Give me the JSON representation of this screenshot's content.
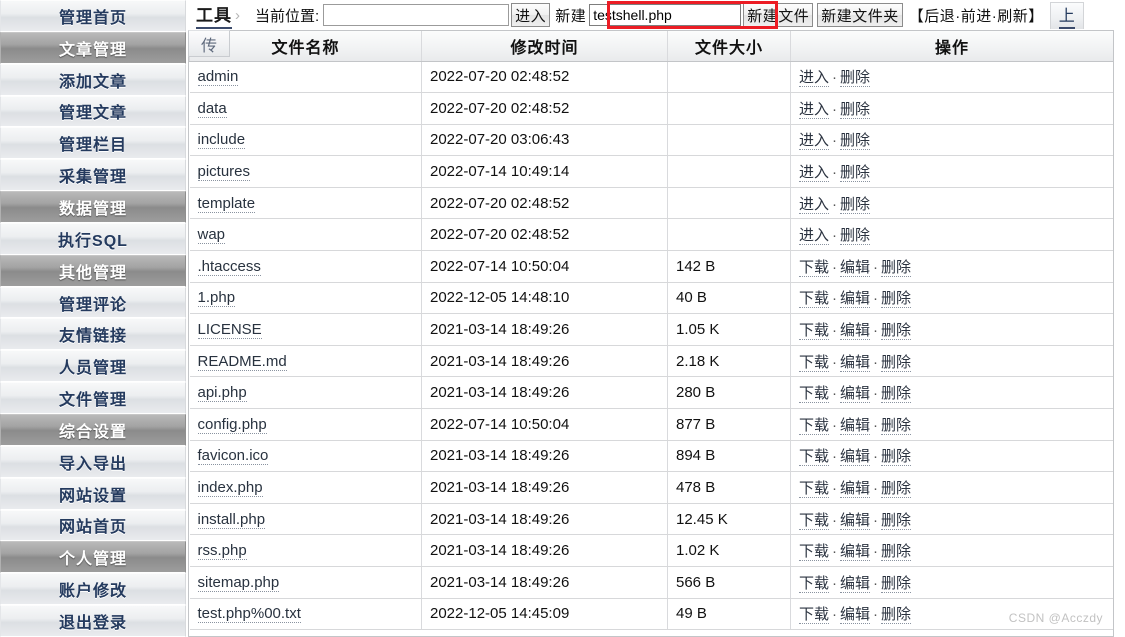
{
  "sidebar": {
    "items": [
      {
        "label": "管理首页",
        "type": "normal"
      },
      {
        "label": "文章管理",
        "type": "header"
      },
      {
        "label": "添加文章",
        "type": "normal"
      },
      {
        "label": "管理文章",
        "type": "normal"
      },
      {
        "label": "管理栏目",
        "type": "normal"
      },
      {
        "label": "采集管理",
        "type": "normal"
      },
      {
        "label": "数据管理",
        "type": "header"
      },
      {
        "label": "执行SQL",
        "type": "normal"
      },
      {
        "label": "其他管理",
        "type": "header"
      },
      {
        "label": "管理评论",
        "type": "normal"
      },
      {
        "label": "友情链接",
        "type": "normal"
      },
      {
        "label": "人员管理",
        "type": "normal"
      },
      {
        "label": "文件管理",
        "type": "normal"
      },
      {
        "label": "综合设置",
        "type": "header"
      },
      {
        "label": "导入导出",
        "type": "normal"
      },
      {
        "label": "网站设置",
        "type": "normal"
      },
      {
        "label": "网站首页",
        "type": "normal"
      },
      {
        "label": "个人管理",
        "type": "header"
      },
      {
        "label": "账户修改",
        "type": "normal"
      },
      {
        "label": "退出登录",
        "type": "normal"
      }
    ]
  },
  "toolbar": {
    "tools_tab": "工具",
    "chevron": "›",
    "location_label": "当前位置:",
    "location_value": "",
    "location_placeholder": "",
    "enter_button": "进入",
    "new_label": "新建",
    "new_name_value": "testshell.php",
    "new_name_placeholder": "",
    "new_file_button": "新建文件",
    "new_folder_button": "新建文件夹",
    "nav_open": "【",
    "nav_back": "后退",
    "nav_dot1": "·",
    "nav_forward": "前进",
    "nav_dot2": "·",
    "nav_refresh": "刷新",
    "nav_close": "】",
    "up_tab": "上",
    "upload_tab": "传",
    "annotation_color": "#ec1c24"
  },
  "table": {
    "headers": {
      "name": "文件名称",
      "time": "修改时间",
      "size": "文件大小",
      "action": "操作"
    },
    "action_labels": {
      "enter": "进入",
      "download": "下载",
      "edit": "编辑",
      "delete": "删除",
      "separator": "·"
    },
    "rows": [
      {
        "name": "admin",
        "time": "2022-07-20 02:48:52",
        "size": "",
        "kind": "dir"
      },
      {
        "name": "data",
        "time": "2022-07-20 02:48:52",
        "size": "",
        "kind": "dir"
      },
      {
        "name": "include",
        "time": "2022-07-20 03:06:43",
        "size": "",
        "kind": "dir"
      },
      {
        "name": "pictures",
        "time": "2022-07-14 10:49:14",
        "size": "",
        "kind": "dir"
      },
      {
        "name": "template",
        "time": "2022-07-20 02:48:52",
        "size": "",
        "kind": "dir"
      },
      {
        "name": "wap",
        "time": "2022-07-20 02:48:52",
        "size": "",
        "kind": "dir"
      },
      {
        "name": ".htaccess",
        "time": "2022-07-14 10:50:04",
        "size": "142 B",
        "kind": "file"
      },
      {
        "name": "1.php",
        "time": "2022-12-05 14:48:10",
        "size": "40 B",
        "kind": "file"
      },
      {
        "name": "LICENSE",
        "time": "2021-03-14 18:49:26",
        "size": "1.05 K",
        "kind": "file"
      },
      {
        "name": "README.md",
        "time": "2021-03-14 18:49:26",
        "size": "2.18 K",
        "kind": "file"
      },
      {
        "name": "api.php",
        "time": "2021-03-14 18:49:26",
        "size": "280 B",
        "kind": "file"
      },
      {
        "name": "config.php",
        "time": "2022-07-14 10:50:04",
        "size": "877 B",
        "kind": "file"
      },
      {
        "name": "favicon.ico",
        "time": "2021-03-14 18:49:26",
        "size": "894 B",
        "kind": "file"
      },
      {
        "name": "index.php",
        "time": "2021-03-14 18:49:26",
        "size": "478 B",
        "kind": "file"
      },
      {
        "name": "install.php",
        "time": "2021-03-14 18:49:26",
        "size": "12.45 K",
        "kind": "file"
      },
      {
        "name": "rss.php",
        "time": "2021-03-14 18:49:26",
        "size": "1.02 K",
        "kind": "file"
      },
      {
        "name": "sitemap.php",
        "time": "2021-03-14 18:49:26",
        "size": "566 B",
        "kind": "file"
      },
      {
        "name": "test.php%00.txt",
        "time": "2022-12-05 14:45:09",
        "size": "49 B",
        "kind": "file"
      }
    ]
  },
  "watermark": "CSDN @Acczdy"
}
